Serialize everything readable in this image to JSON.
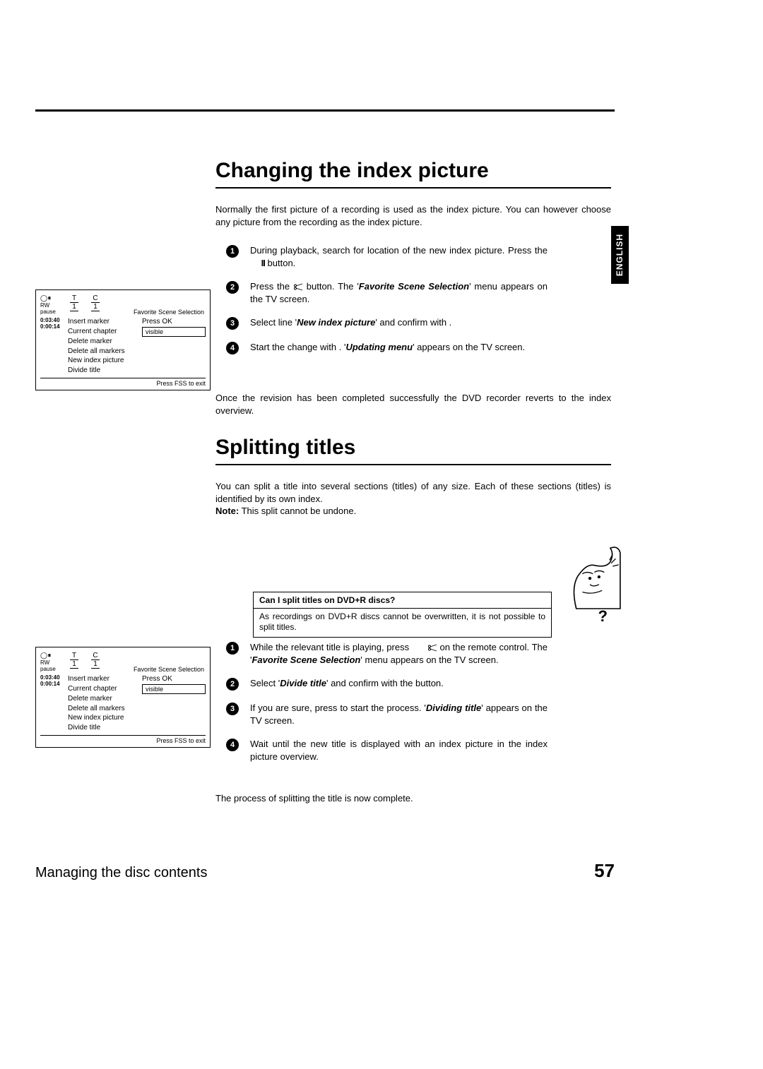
{
  "language_tab": "ENGLISH",
  "heading1": "Changing the index picture",
  "heading2": "Splitting titles",
  "intro1": "Normally the first picture of a recording is used as the index picture. You can however choose any picture from the recording as the index picture.",
  "intro2_a": "You can split a title into several sections (titles) of any size. Each of these sections (titles) is identified by its own index.",
  "intro2_note_label": "Note:",
  "intro2_note_text": " This split cannot be undone.",
  "steps1": {
    "s1_a": "During playback, search for location of the new index picture. Press the ",
    "s1_b": " button.",
    "s2_a": "Press the ",
    "s2_b": " button. The '",
    "s2_c": "Favorite Scene Selection",
    "s2_d": "' menu appears on the TV screen.",
    "s3_a": "Select line '",
    "s3_b": "New index picture",
    "s3_c": "' and confirm with            .",
    "s4_a": "Start the change with           . '",
    "s4_b": "Updating menu",
    "s4_c": "' appears on the TV screen."
  },
  "after_steps1": "Once the revision has been completed successfully the DVD recorder reverts to the index overview.",
  "notebox": {
    "title": "Can I split titles on DVD+R discs?",
    "body": "As recordings on DVD+R discs cannot be overwritten, it is not possible to split titles."
  },
  "steps2": {
    "s1_a": "While the relevant title is playing, press ",
    "s1_b": " on the remote control. The '",
    "s1_c": "Favorite Scene Selection",
    "s1_d": "' menu appears on the TV screen.",
    "s2_a": "Select '",
    "s2_b": "Divide title",
    "s2_c": "' and confirm with the          button.",
    "s3_a": "If you are sure, press           to start the process. '",
    "s3_b": "Dividing title",
    "s3_c": "' appears on the TV screen.",
    "s4": "Wait until the new title is displayed with an index picture in the index picture overview."
  },
  "after_steps2": "The process of splitting the title is now complete.",
  "osd": {
    "header_right": "Favorite Scene Selection",
    "left_sym": "⏸",
    "left_rw": "RW  pause",
    "t_label": "T",
    "c_label": "C",
    "t_val": "1",
    "c_val": "1",
    "time1": "0:03:40",
    "time2": "0:00:14",
    "rows": [
      {
        "l": "Insert marker",
        "r": "Press OK",
        "boxed": false
      },
      {
        "l": "Current chapter",
        "r": "visible",
        "boxed": true
      },
      {
        "l": "Delete marker",
        "r": "",
        "boxed": false
      },
      {
        "l": "Delete all markers",
        "r": "",
        "boxed": false
      },
      {
        "l": "New index picture",
        "r": "",
        "boxed": false
      },
      {
        "l": "Divide title",
        "r": "",
        "boxed": false
      }
    ],
    "footer": "Press FSS to exit"
  },
  "footer_section": "Managing the disc contents",
  "footer_page": "57",
  "qmark": "?"
}
